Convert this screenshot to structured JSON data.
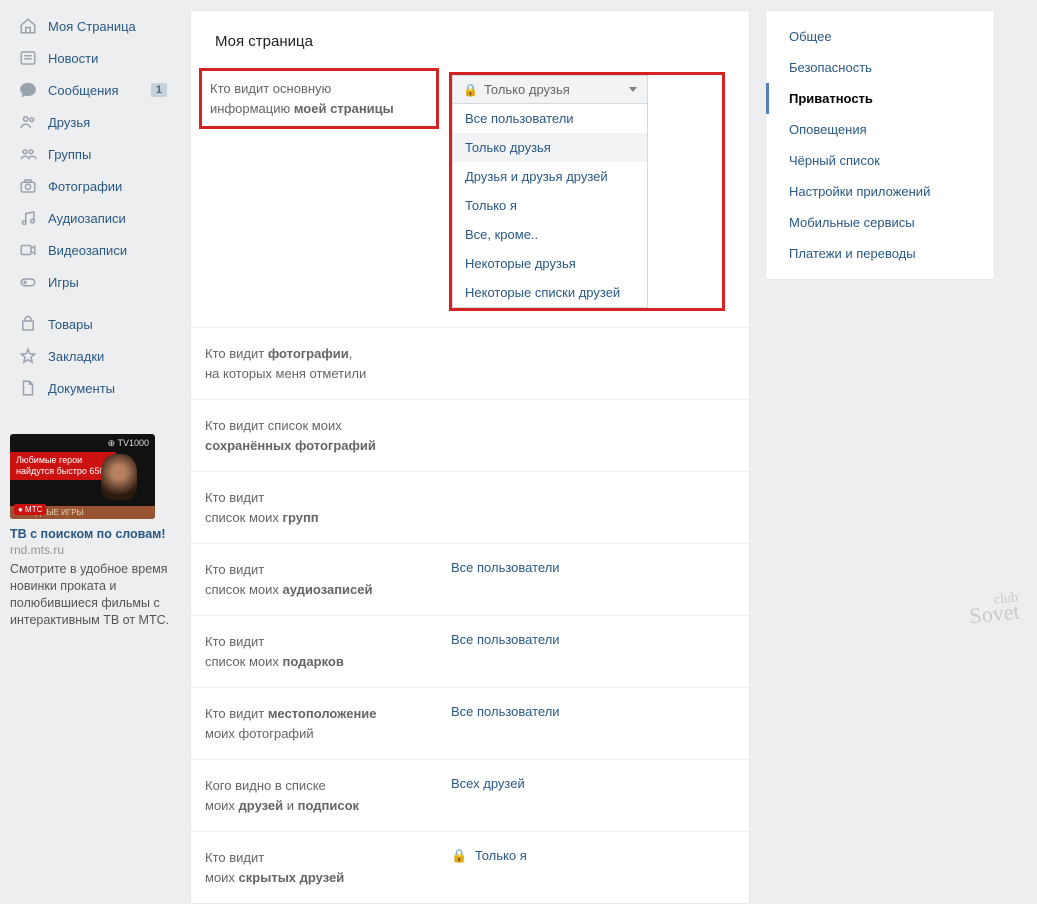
{
  "leftnav": {
    "items": [
      {
        "icon": "home",
        "label": "Моя Страница"
      },
      {
        "icon": "news",
        "label": "Новости"
      },
      {
        "icon": "msg",
        "label": "Сообщения",
        "badge": "1"
      },
      {
        "icon": "friends",
        "label": "Друзья"
      },
      {
        "icon": "groups",
        "label": "Группы"
      },
      {
        "icon": "photos",
        "label": "Фотографии"
      },
      {
        "icon": "audio",
        "label": "Аудиозаписи"
      },
      {
        "icon": "video",
        "label": "Видеозаписи"
      },
      {
        "icon": "games",
        "label": "Игры"
      },
      {
        "icon": "market",
        "label": "Товары"
      },
      {
        "icon": "star",
        "label": "Закладки"
      },
      {
        "icon": "docs",
        "label": "Документы"
      }
    ]
  },
  "ad": {
    "tv": "⊕ TV1000",
    "red_line1": "Любимые герои",
    "red_line2": "найдутся быстро",
    "price": "650₽",
    "bottom": "ГОЛОДНЫЕ ИГРЫ",
    "mts": "● МТС",
    "title": "ТВ с поиском по словам!",
    "domain": "rnd.mts.ru",
    "text": "Смотрите в удобное время новинки проката и полюбившиеся фильмы с интерактивным ТВ от МТС."
  },
  "main": {
    "title": "Моя страница",
    "rows": [
      {
        "l1": "Кто видит основную",
        "l2_pre": "информацию ",
        "l2_b": "моей страницы",
        "value": "",
        "dropdown": true
      },
      {
        "l1_pre": "Кто видит ",
        "l1_b": "фотографии",
        "l1_post": ",",
        "l2": "на которых меня отметили",
        "value": ""
      },
      {
        "l1": "Кто видит список моих",
        "l2_b": "сохранённых фотографий",
        "value": ""
      },
      {
        "l1": "Кто видит",
        "l2_pre": "список моих ",
        "l2_b": "групп",
        "value": ""
      },
      {
        "l1": "Кто видит",
        "l2_pre": "список моих ",
        "l2_b": "аудиозаписей",
        "value": "Все пользователи"
      },
      {
        "l1": "Кто видит",
        "l2_pre": "список моих ",
        "l2_b": "подарков",
        "value": "Все пользователи"
      },
      {
        "l1_pre": "Кто видит ",
        "l1_b": "местоположение",
        "l2": "моих фотографий",
        "value": "Все пользователи"
      },
      {
        "l1": "Кого видно в списке",
        "l2_pre": "моих ",
        "l2_b": "друзей",
        "l2_post": " и ",
        "l2_b2": "подписок",
        "value": "Всех друзей"
      },
      {
        "l1": "Кто видит",
        "l2_pre": "моих ",
        "l2_b": "скрытых друзей",
        "value": "Только я",
        "locked": true
      }
    ],
    "dropdown": {
      "selected": "Только друзья",
      "options": [
        "Все пользователи",
        "Только друзья",
        "Друзья и друзья друзей",
        "Только я",
        "Все, кроме..",
        "Некоторые друзья",
        "Некоторые списки друзей"
      ]
    }
  },
  "rightnav": {
    "items": [
      {
        "label": "Общее"
      },
      {
        "label": "Безопасность"
      },
      {
        "label": "Приватность",
        "active": true
      },
      {
        "label": "Оповещения"
      },
      {
        "label": "Чёрный список"
      },
      {
        "label": "Настройки приложений"
      },
      {
        "label": "Мобильные сервисы"
      },
      {
        "label": "Платежи и переводы"
      }
    ]
  },
  "watermark": {
    "top": "club",
    "main": "Sovet"
  }
}
